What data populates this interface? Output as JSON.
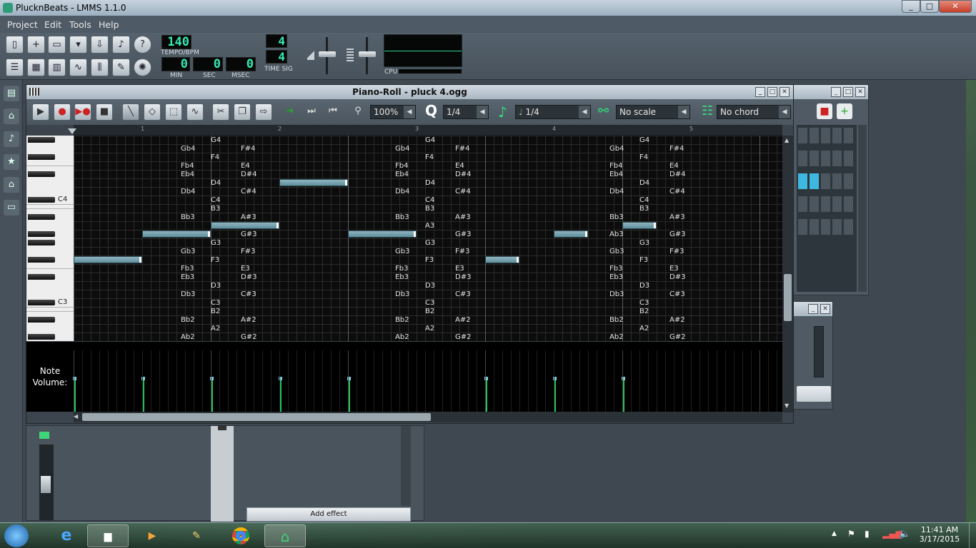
{
  "window": {
    "title": "PlucknBeats - LMMS 1.1.0",
    "minimize": "_",
    "maximize": "□",
    "close": "✕"
  },
  "menu": [
    "Project",
    "Edit",
    "Tools",
    "Help"
  ],
  "toolbar": {
    "tempo_value": "140",
    "tempo_label": "TEMPO/BPM",
    "min_value": "0",
    "min_label": "MIN",
    "sec_value": "0",
    "sec_label": "SEC",
    "msec_value": "0",
    "msec_label": "MSEC",
    "timesig_num": "4",
    "timesig_den": "4",
    "timesig_label": "TIME SIG",
    "cpu_label": "CPU"
  },
  "piano_roll": {
    "title": "Piano-Roll - pluck 4.ogg",
    "zoom": "100%",
    "quantize_label": "Q",
    "quantize": "1/4",
    "note_length": "1/4",
    "scale": "No scale",
    "chord": "No chord",
    "bar_numbers": [
      "1",
      "2",
      "3",
      "4",
      "5"
    ],
    "key_labels": [
      "C4",
      "C3"
    ],
    "note_name_rows": [
      [
        "G4"
      ],
      [
        "Gb4",
        "F#4"
      ],
      [
        "F4"
      ],
      [
        "Fb4",
        "E4"
      ],
      [
        "Eb4",
        "D#4"
      ],
      [
        "D4"
      ],
      [
        "Db4",
        "C#4"
      ],
      [
        "C4"
      ],
      [
        "B3"
      ],
      [
        "Bb3",
        "A#3"
      ],
      [
        "A3"
      ],
      [
        "Ab3",
        "G#3"
      ],
      [
        "G3"
      ],
      [
        "Gb3",
        "F#3"
      ],
      [
        "F3"
      ],
      [
        "Fb3",
        "E3"
      ],
      [
        "Eb3",
        "D#3"
      ],
      [
        "D3"
      ],
      [
        "Db3",
        "C#3"
      ],
      [
        "C3"
      ],
      [
        "B2"
      ],
      [
        "Bb2",
        "A#2"
      ],
      [
        "A2"
      ],
      [
        "Ab2",
        "G#2"
      ]
    ],
    "volume_label": "Note Volume:"
  },
  "mixer": {
    "add_effect": "Add effect"
  },
  "taskbar": {
    "time": "11:41 AM",
    "date": "3/17/2015"
  }
}
